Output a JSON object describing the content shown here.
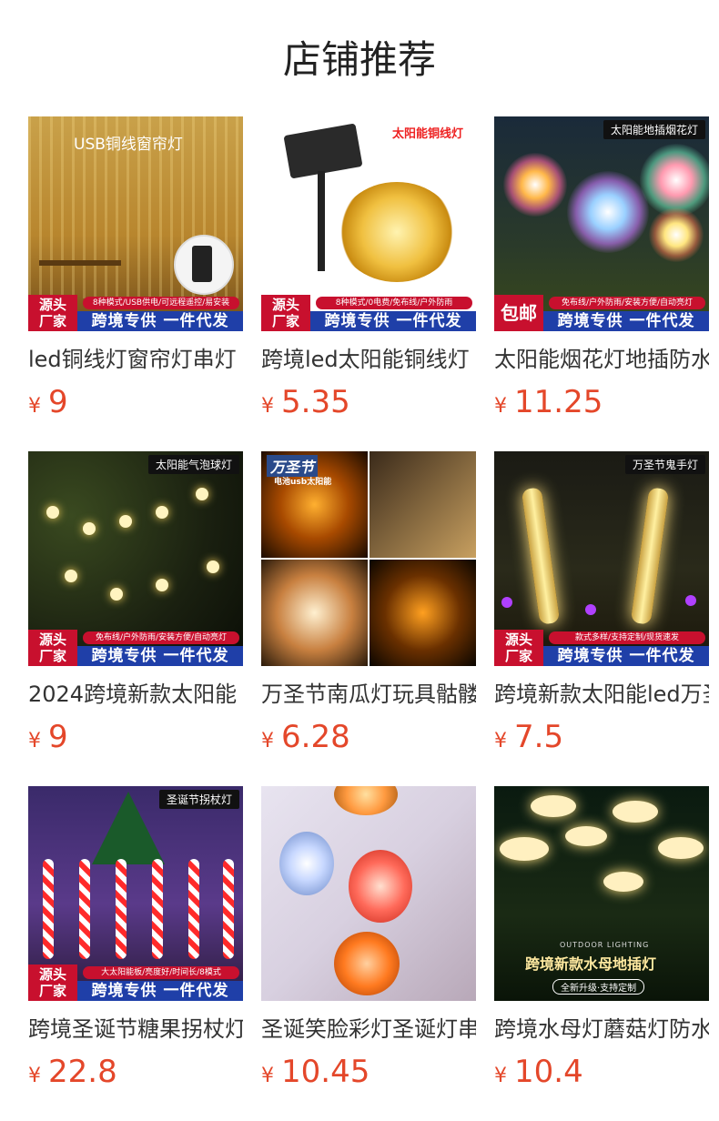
{
  "page": {
    "title": "店铺推荐"
  },
  "products": [
    {
      "name": "led铜线灯窗帘灯串灯",
      "price": "9",
      "currency": "¥",
      "image": {
        "overlay_title": "USB铜线窗帘灯",
        "badge_left": "源头\n厂家",
        "tagline": "8种模式/USB供电/可远程遥控/易安装",
        "banner": "跨境专供 一件代发"
      }
    },
    {
      "name": "跨境led太阳能铜线灯",
      "price": "5.35",
      "currency": "¥",
      "image": {
        "corner_tag": "太阳能铜线灯",
        "badge_left": "源头\n厂家",
        "tagline": "8种模式/0电费/免布线/户外防雨",
        "banner": "跨境专供 一件代发"
      }
    },
    {
      "name": "太阳能烟花灯地插防水",
      "price": "11.25",
      "currency": "¥",
      "image": {
        "corner_tag": "太阳能地插烟花灯",
        "badge_left": "包邮",
        "tagline": "免布线/户外防雨/安装方便/自动亮灯",
        "banner": "跨境专供 一件代发"
      }
    },
    {
      "name": "2024跨境新款太阳能",
      "price": "9",
      "currency": "¥",
      "image": {
        "corner_tag": "太阳能气泡球灯",
        "badge_left": "源头\n厂家",
        "tagline": "免布线/户外防雨/安装方便/自动亮灯",
        "banner": "跨境专供 一件代发"
      }
    },
    {
      "name": "万圣节南瓜灯玩具骷髅",
      "price": "6.28",
      "currency": "¥",
      "image": {
        "corner_tag": "万圣节",
        "sub_tag": "电池usb太阳能"
      }
    },
    {
      "name": "跨境新款太阳能led万圣",
      "price": "7.5",
      "currency": "¥",
      "image": {
        "corner_tag": "万圣节鬼手灯",
        "badge_left": "源头\n厂家",
        "tagline": "款式多样/支持定制/现货速发",
        "banner": "跨境专供 一件代发"
      }
    },
    {
      "name": "跨境圣诞节糖果拐杖灯",
      "price": "22.8",
      "currency": "¥",
      "image": {
        "corner_tag": "圣诞节拐杖灯",
        "badge_left": "源头\n厂家",
        "tagline": "大太阳能板/亮度好/时间长/8模式",
        "banner": "跨境专供 一件代发"
      }
    },
    {
      "name": "圣诞笑脸彩灯圣诞灯串",
      "price": "10.45",
      "currency": "¥",
      "image": {}
    },
    {
      "name": "跨境水母灯蘑菇灯防水",
      "price": "10.4",
      "currency": "¥",
      "image": {
        "small_caption": "OUTDOOR LIGHTING",
        "overlay_title": "跨境新款水母地插灯",
        "pill": "全新升级·支持定制"
      }
    }
  ],
  "colors": {
    "price": "#e4472a",
    "banner_blue": "#1f3fa8",
    "badge_red": "#c8102e"
  }
}
